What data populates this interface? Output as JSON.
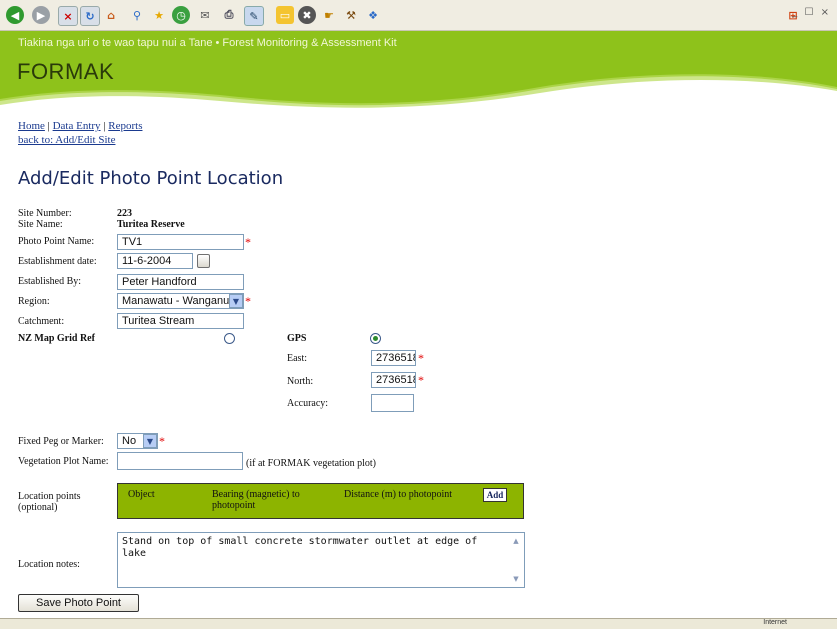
{
  "browser": {
    "toolbar_icons": [
      "back-icon",
      "forward-icon",
      "stop-icon",
      "refresh-icon",
      "home-icon",
      "search-icon",
      "favorites-icon",
      "history-icon",
      "mail-icon",
      "print-icon",
      "edit-icon",
      "discuss-icon",
      "folder-icon",
      "messenger-icon",
      "research-icon",
      "tools-icon",
      "dropbox-icon"
    ],
    "window_controls": "_ ☐ ×"
  },
  "banner": {
    "tagline": "Tiakina nga uri o te wao tapu nui a Tane • Forest Monitoring & Assessment Kit",
    "brand": "FORMAK",
    "colors": {
      "accent": "#8ec21b",
      "brand_text": "#2a3a0a"
    }
  },
  "nav": {
    "home": "Home",
    "sep1": " | ",
    "data_entry": "Data Entry",
    "sep2": " | ",
    "reports": "Reports",
    "back": "back to: Add/Edit Site"
  },
  "page_title": "Add/Edit Photo Point Location",
  "form": {
    "site_number_label": "Site Number:",
    "site_number": "223",
    "site_name_label": "Site Name:",
    "site_name": "Turitea Reserve",
    "photo_point_name_label": "Photo Point Name:",
    "photo_point_name": "TV1",
    "established_date_label": "Establishment date:",
    "established_date": "11-6-2004",
    "established_by_label": "Established By:",
    "established_by": "Peter Handford",
    "region_label": "Region:",
    "region": "Manawatu - Wanganui",
    "catchment_label": "Catchment:",
    "catchment": "Turitea Stream",
    "nzmg_label": "NZ Map Grid Ref",
    "gps_label": "GPS",
    "east_label": "East:",
    "east": "2736518",
    "north_label": "North:",
    "north": "2736518",
    "accuracy_label": "Accuracy:",
    "accuracy": "",
    "fixed_peg_label": "Fixed Peg or Marker:",
    "fixed_peg": "No",
    "veg_plot_label": "Vegetation Plot Name:",
    "veg_plot": "",
    "veg_plot_hint": "(if at FORMAK vegetation plot)",
    "location_points_label": "Location points",
    "location_points_optional": "(optional)",
    "lp_object": "Object",
    "lp_bearing": "Bearing (magnetic) to photopoint",
    "lp_distance": "Distance (m) to photopoint",
    "lp_add": "Add",
    "location_notes_label": "Location notes:",
    "location_notes": "Stand on top of small concrete stormwater outlet at edge of lake",
    "save_button": "Save Photo Point",
    "required_mark": "*"
  },
  "statusbar": {
    "zone": "Internet"
  }
}
